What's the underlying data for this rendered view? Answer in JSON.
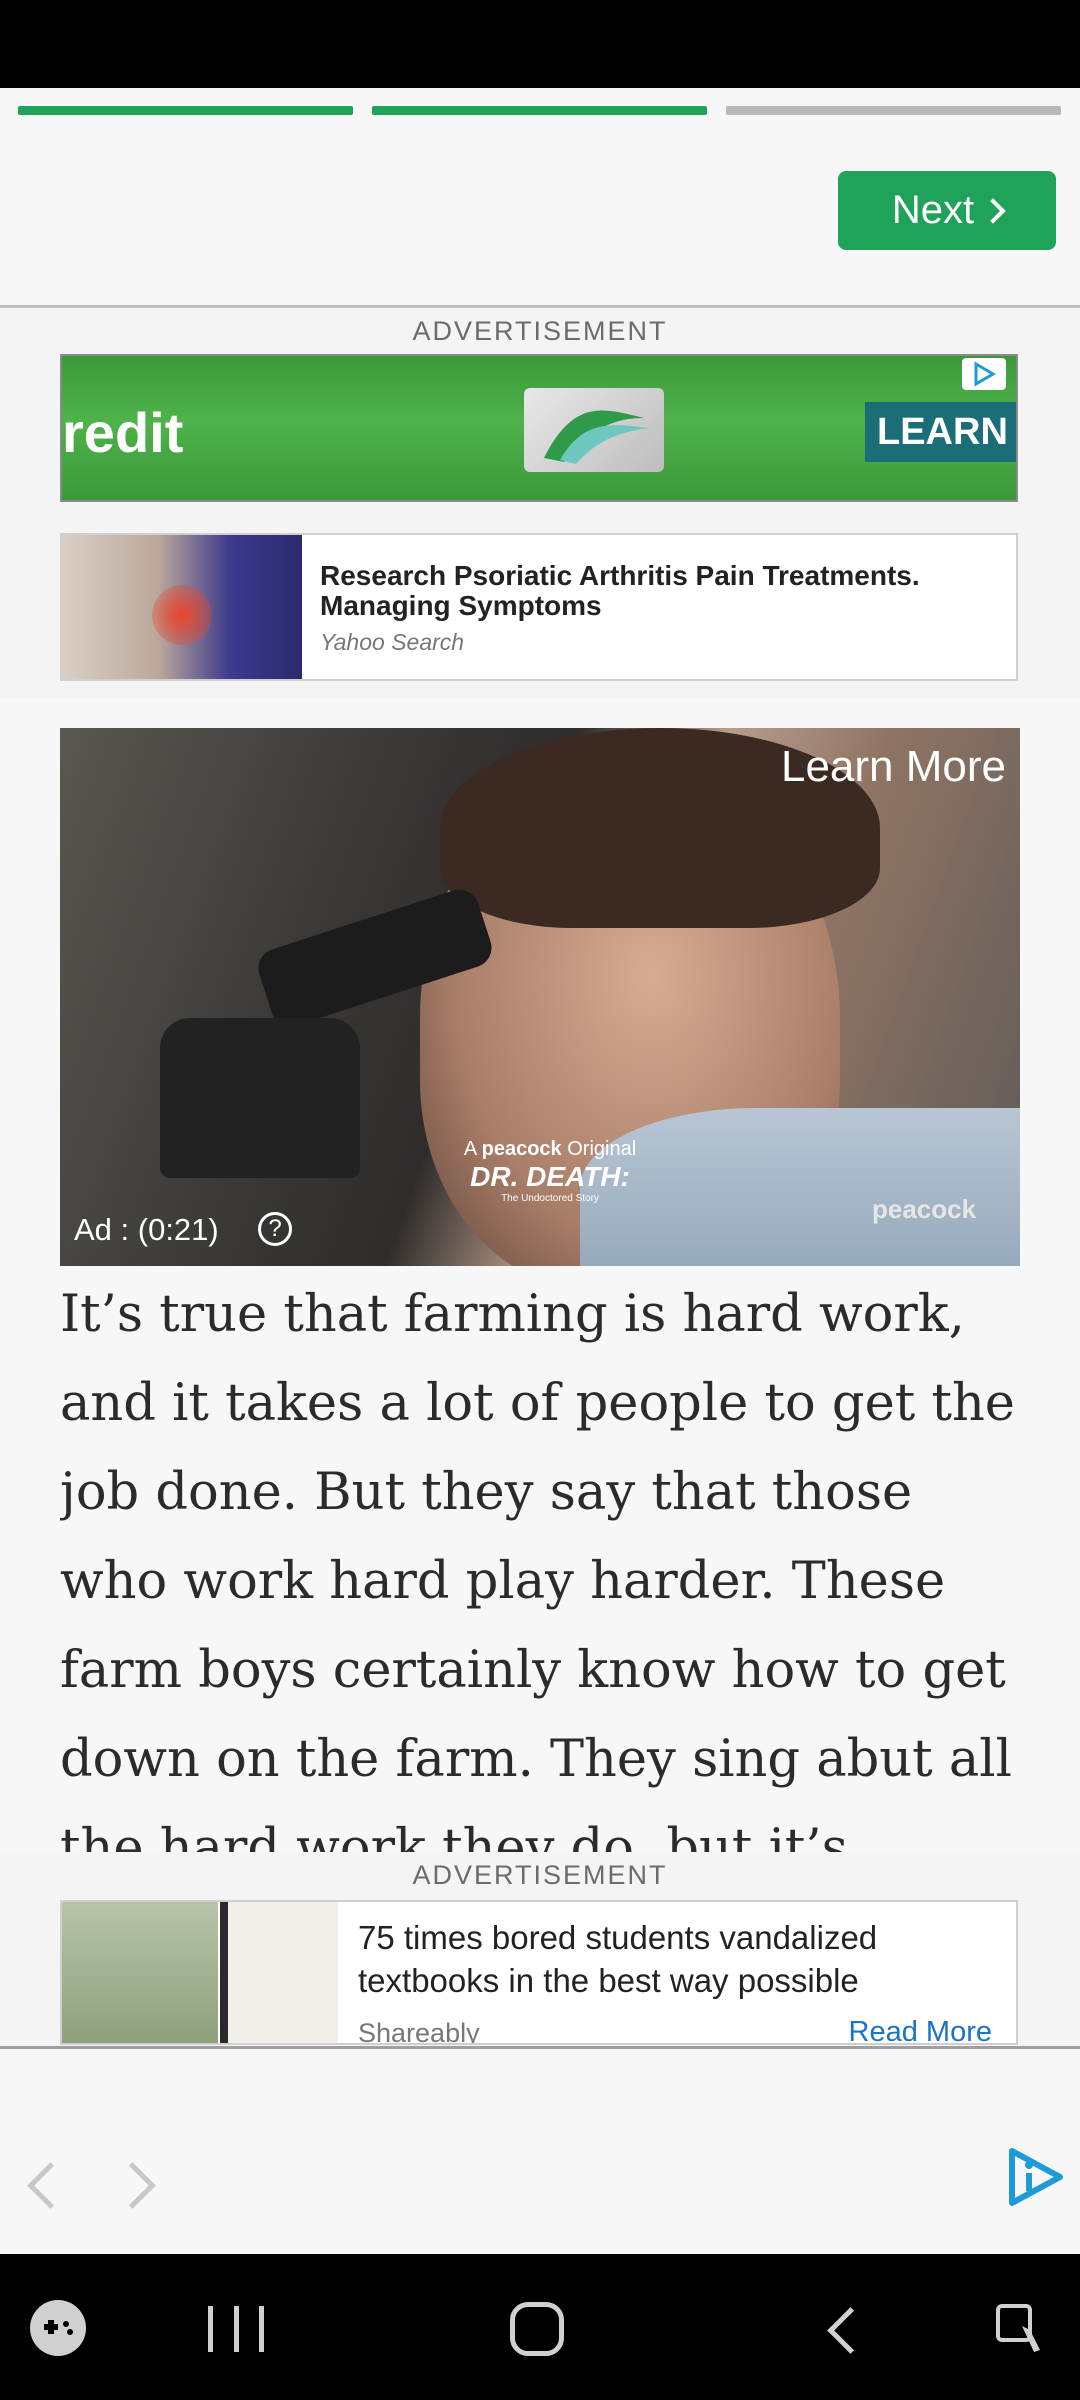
{
  "top_nav": {
    "next_label": "Next",
    "progress": [
      {
        "color": "#1fa35a"
      },
      {
        "color": "#1fa35a"
      },
      {
        "color": "#b8b8b8"
      }
    ]
  },
  "ads": {
    "label_top": "ADVERTISEMENT",
    "label_bottom": "ADVERTISEMENT",
    "banner": {
      "text_left": "redit",
      "cta": "LEARN"
    },
    "search": {
      "title": "Research Psoriatic Arthritis Pain Treatments. Managing Symptoms",
      "source": "Yahoo Search"
    },
    "video": {
      "learn_more": "Learn More",
      "timer": "Ad : (0:21)",
      "help": "?",
      "overlay_small": "A",
      "overlay_brand": "peacock",
      "overlay_original": "Original",
      "overlay_title": "DR. DEATH:",
      "overlay_subtitle": "The Undoctored Story",
      "watermark": "peacock"
    },
    "bottom": {
      "title": "75 times bored students vandalized textbooks in the best way possible",
      "source": "Shareably",
      "cta": "Read More"
    }
  },
  "article": {
    "text": "It’s true that farming is hard work, and it takes a lot of people to get the job done. But they say that those who work hard play harder. These farm boys certainly know how to get down on the farm. They sing abut all the hard work they do, but it’s pretty clear they like to"
  },
  "colors": {
    "accent_green": "#1fa35a",
    "link_blue": "#1a73c8",
    "brand_cyan": "#1e9bd7"
  }
}
